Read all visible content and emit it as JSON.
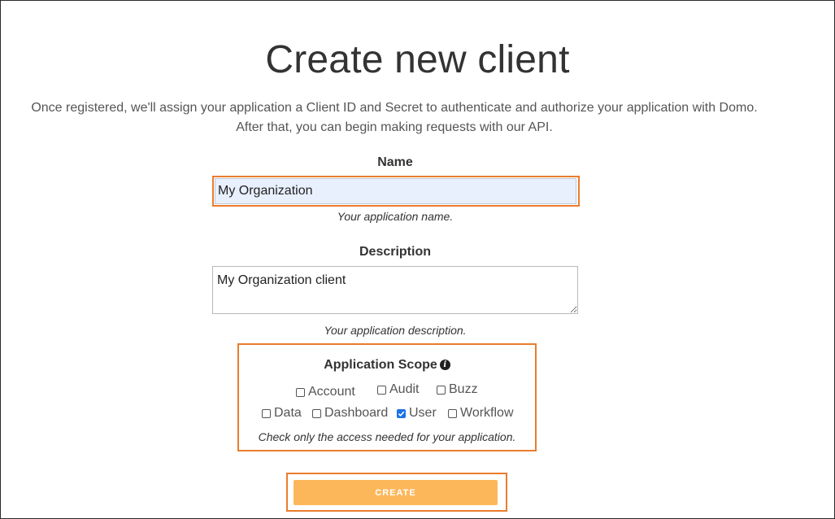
{
  "page": {
    "title": "Create new client",
    "intro_line1": "Once registered, we'll assign your application a Client ID and Secret to authenticate and authorize your application with Domo.",
    "intro_line2": "After that, you can begin making requests with our API."
  },
  "form": {
    "name": {
      "label": "Name",
      "value": "My Organization",
      "helper": "Your application name."
    },
    "description": {
      "label": "Description",
      "value": "My Organization client",
      "helper": "Your application description."
    },
    "scope": {
      "title": "Application Scope",
      "info_icon": "info-icon",
      "options": [
        {
          "label": "Account",
          "checked": false
        },
        {
          "label": "Audit",
          "checked": false
        },
        {
          "label": "Buzz",
          "checked": false
        },
        {
          "label": "Data",
          "checked": false
        },
        {
          "label": "Dashboard",
          "checked": false
        },
        {
          "label": "User",
          "checked": true
        },
        {
          "label": "Workflow",
          "checked": false
        }
      ],
      "hint": "Check only the access needed for your application."
    },
    "submit_label": "CREATE"
  },
  "colors": {
    "highlight": "#ea7d2d",
    "button": "#fdb75b",
    "checkbox_checked": "#1a73e8",
    "name_input_bg": "#e8f0fe"
  }
}
